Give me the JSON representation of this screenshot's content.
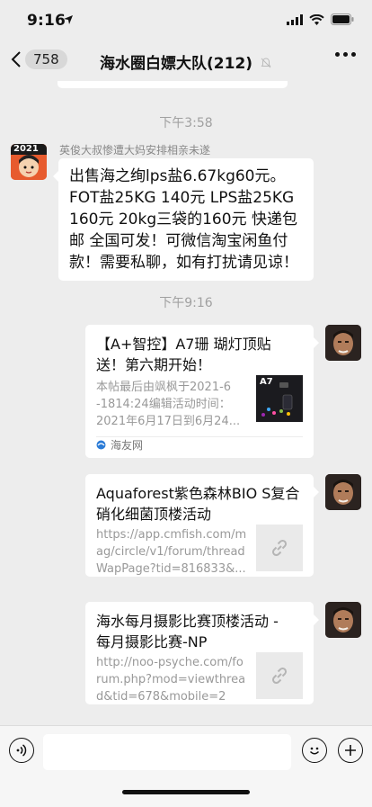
{
  "status_bar": {
    "time": "9:16"
  },
  "nav": {
    "back_count": "758",
    "title": "海水圈白嫖大队(212)"
  },
  "timestamps": {
    "first": "下午3:58",
    "second": "下午9:16"
  },
  "message1": {
    "sender": "英俊大叔惨遭大妈安排相亲未遂",
    "avatar_label": "2021",
    "line1": "出售海之绚lps盐6.67kg60元。",
    "line2": "FOT盐25KG 140元 LPS盐25KG",
    "line3": "160元  20kg三袋的160元 快递包",
    "line4": "邮 全国可发！可微信淘宝闲鱼付",
    "line5": "款！需要私聊，如有打扰请见谅！"
  },
  "card1": {
    "title1": "【A+智控】A7珊 瑚灯顶贴",
    "title2": "送！第六期开始！",
    "desc1": "本帖最后由飒枫于2021-6",
    "desc2": "-1814:24编辑活动时间：",
    "desc3": "2021年6月17日到6月24...",
    "thumb_label": "A7",
    "source": "海友网"
  },
  "card2": {
    "title1": "Aquaforest紫色森林BIO S复合",
    "title2": "硝化细菌顶楼活动",
    "desc1": "https://app.cmfish.com/m",
    "desc2": "ag/circle/v1/forum/thread",
    "desc3": "WapPage?tid=816833&..."
  },
  "card3": {
    "title1": "海水每月摄影比赛顶楼活动 -",
    "title2": "每月摄影比赛-NP",
    "desc1": "http://noo-psyche.com/fo",
    "desc2": "rum.php?mod=viewthrea",
    "desc3": "d&tid=678&mobile=2"
  },
  "icons": {
    "voice": "voice-icon",
    "emoji": "emoji-icon",
    "plus": "plus-icon",
    "link": "link-icon",
    "mute": "mute-bell-icon"
  },
  "colors": {
    "background": "#ededed",
    "bubble": "#ffffff",
    "timestamp": "#a0a0a0"
  }
}
